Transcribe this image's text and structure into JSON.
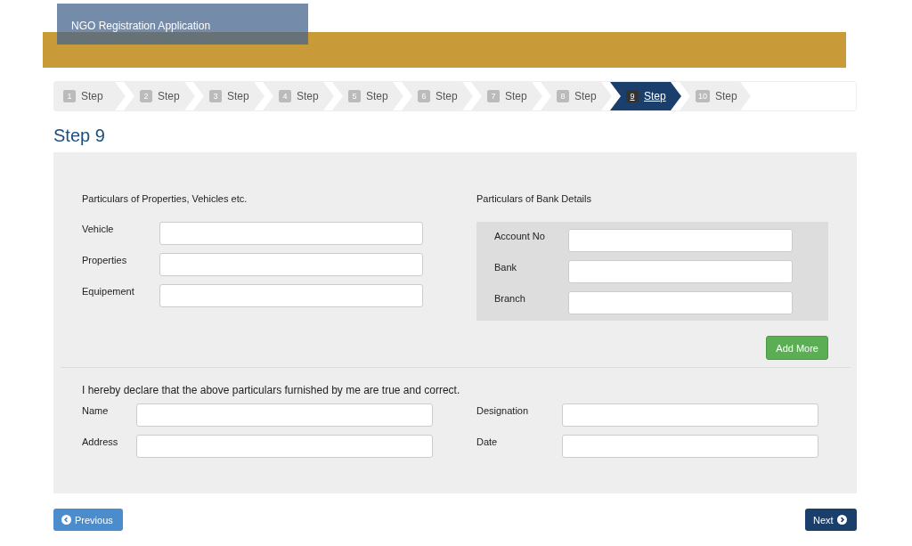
{
  "header": {
    "title": "NGO Registration Application"
  },
  "steps": [
    {
      "number": "1",
      "label": "Step",
      "selected": false
    },
    {
      "number": "2",
      "label": "Step",
      "selected": false
    },
    {
      "number": "3",
      "label": "Step",
      "selected": false
    },
    {
      "number": "4",
      "label": "Step",
      "selected": false
    },
    {
      "number": "5",
      "label": "Step",
      "selected": false
    },
    {
      "number": "6",
      "label": "Step",
      "selected": false
    },
    {
      "number": "7",
      "label": "Step",
      "selected": false
    },
    {
      "number": "8",
      "label": "Step",
      "selected": false
    },
    {
      "number": "9",
      "label": "Step",
      "selected": true
    },
    {
      "number": "10",
      "label": "Step",
      "selected": false
    }
  ],
  "page_title": "Step 9",
  "properties": {
    "heading": "Particulars of Properties, Vehicles etc.",
    "fields": [
      {
        "label": "Vehicle"
      },
      {
        "label": "Properties"
      },
      {
        "label": "Equipement"
      }
    ]
  },
  "bank": {
    "heading": "Particulars of Bank Details",
    "fields": [
      {
        "label": "Account No"
      },
      {
        "label": "Bank"
      },
      {
        "label": "Branch"
      }
    ],
    "add_button": "Add More"
  },
  "declaration": {
    "text": "I hereby declare that the above particulars furnished by me are true and correct.",
    "left_fields": [
      {
        "label": "Name"
      },
      {
        "label": "Address"
      }
    ],
    "right_fields": [
      {
        "label": "Designation"
      },
      {
        "label": "Date"
      }
    ]
  },
  "buttons": {
    "previous": "Previous",
    "next": "Next"
  }
}
